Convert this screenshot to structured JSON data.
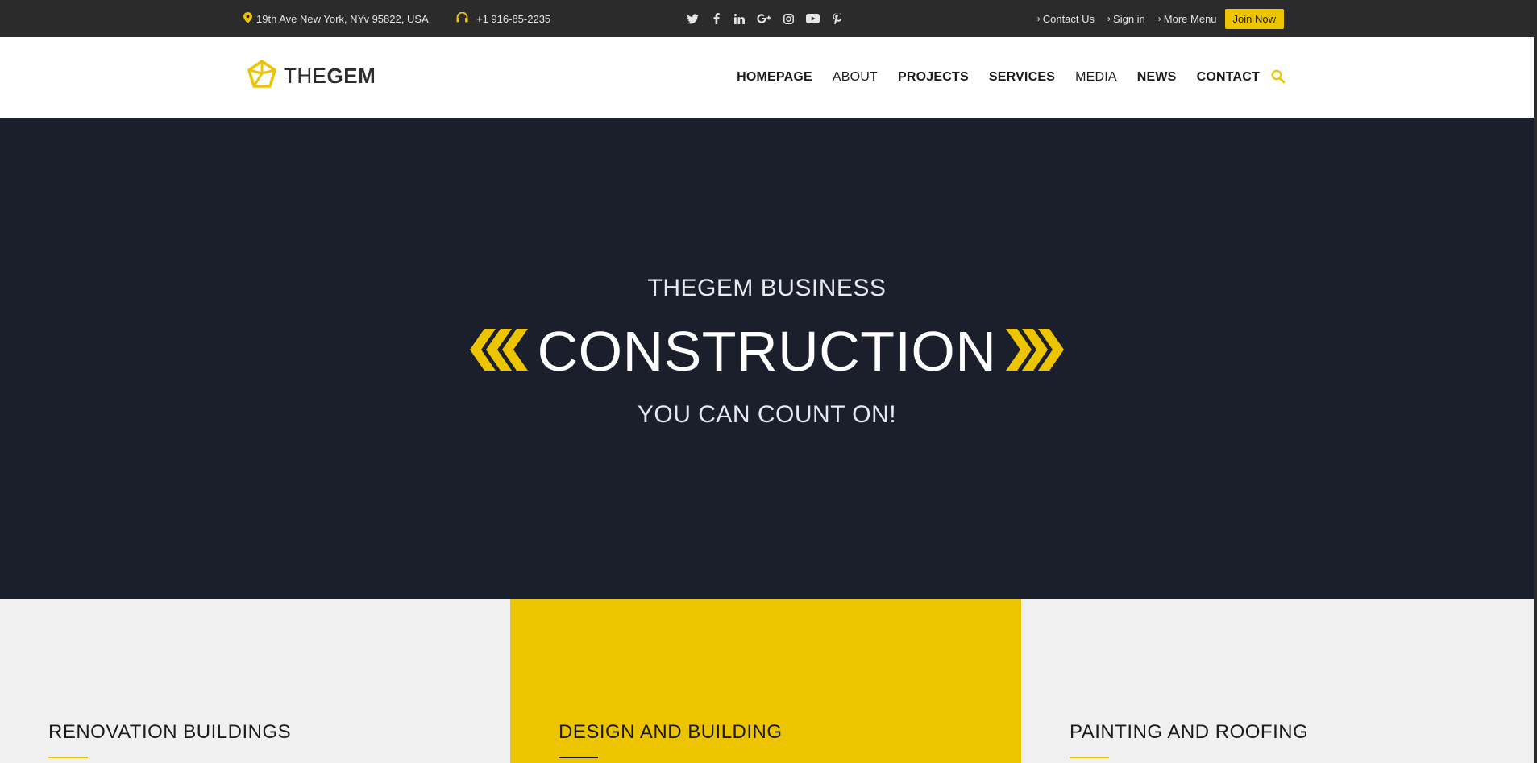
{
  "topbar": {
    "address": "19th Ave New York, NYv 95822, USA",
    "phone": "+1 916-85-2235",
    "social": [
      "twitter-icon",
      "facebook-icon",
      "linkedin-icon",
      "googleplus-icon",
      "instagram-icon",
      "youtube-icon",
      "pinterest-icon"
    ],
    "links": [
      "Contact Us",
      "Sign in",
      "More Menu"
    ],
    "join_label": "Join Now"
  },
  "header": {
    "logo_light": "THE",
    "logo_bold": "GEM",
    "nav": [
      "HOMEPAGE",
      "ABOUT",
      "PROJECTS",
      "SERVICES",
      "MEDIA",
      "NEWS",
      "CONTACT"
    ]
  },
  "hero": {
    "subtitle": "THEGEM BUSINESS",
    "headline": "CONSTRUCTION",
    "tagline": "YOU CAN COUNT ON!"
  },
  "services": [
    {
      "title": "RENOVATION BUILDINGS"
    },
    {
      "title": "DESIGN AND BUILDING"
    },
    {
      "title": "PAINTING AND ROOFING"
    }
  ],
  "colors": {
    "accent": "#edc400",
    "dark": "#1b1f2c",
    "topbar": "#2b2b2b",
    "panel": "#f0f0f0"
  }
}
